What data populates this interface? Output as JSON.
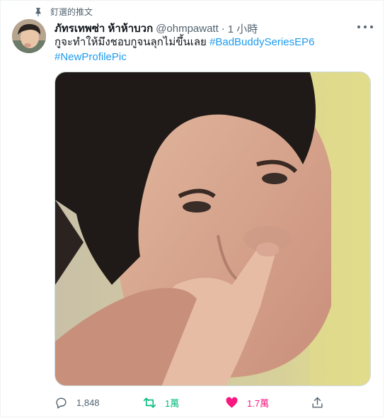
{
  "pinned": {
    "label": "釘選的推文",
    "icon": "pin-icon"
  },
  "author": {
    "display_name": "ภัทรเทพซ่า ห้าห้าบวก",
    "handle": "@ohmpawatt",
    "separator": "·",
    "time": "1 小時"
  },
  "tweet": {
    "text": "กูจะทำให้มึงชอบกูจนลุกไม่ขึ้นเลย",
    "hashtags": [
      "#BadBuddySeriesEP6",
      "#NewProfilePic"
    ]
  },
  "media": {
    "icon": "photo-closeup-boy-thumb-on-lip"
  },
  "actions": {
    "reply": {
      "count": "1,848",
      "icon": "reply-icon"
    },
    "retweet": {
      "count": "1萬",
      "icon": "retweet-icon"
    },
    "like": {
      "count": "1.7萬",
      "icon": "heart-icon"
    },
    "share": {
      "icon": "share-icon"
    }
  },
  "colors": {
    "accent": "#1d9bf0",
    "retweet": "#00ba7c",
    "like": "#f91880",
    "secondary_text": "#536471"
  }
}
